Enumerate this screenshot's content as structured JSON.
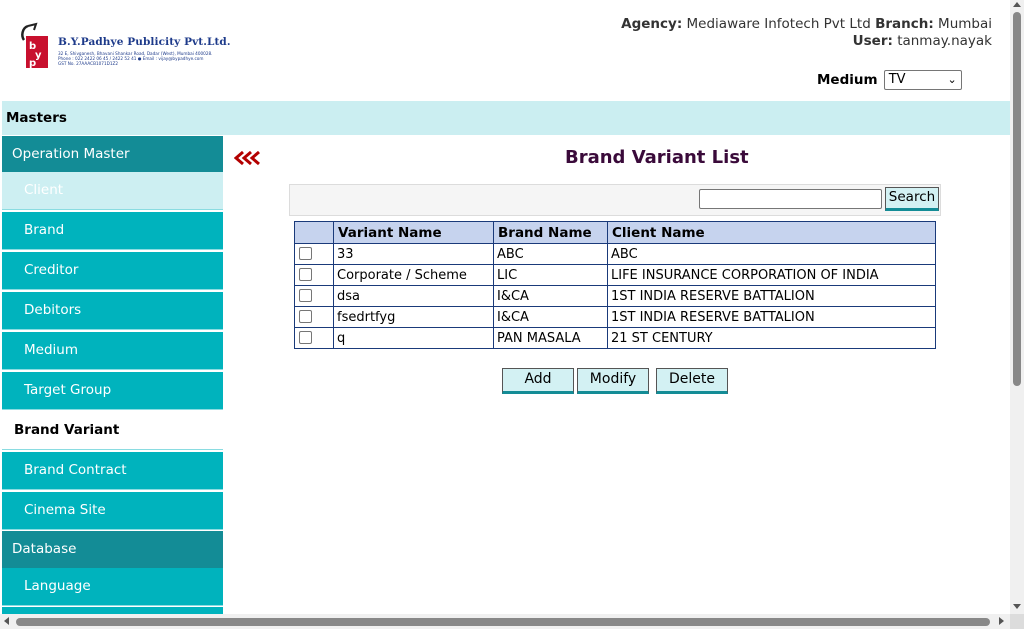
{
  "header": {
    "logo": {
      "company": "B.Y.Padhye Publicity Pvt.Ltd.",
      "address_lines": [
        "32 E, Shivganesh, Bhavani Shankar Road, Dadar (West), Mumbai 400028.",
        "Phone : 022 2422 06 45 / 2422 52 41 ● Email : vijay@bypadhye.com",
        "GST No. 27AAACB1071D1Z2"
      ],
      "mark_letters": "byp"
    },
    "agency_label": "Agency:",
    "agency_value": "Mediaware Infotech Pvt Ltd",
    "branch_label": "Branch:",
    "branch_value": "Mumbai",
    "user_label": "User:",
    "user_value": "tanmay.nayak",
    "medium_label": "Medium",
    "medium_selected": "TV"
  },
  "masters_bar": "Masters",
  "sidebar": [
    {
      "label": "Operation Master",
      "kind": "category"
    },
    {
      "label": "Client",
      "kind": "item",
      "state": "hover"
    },
    {
      "label": "Brand",
      "kind": "item"
    },
    {
      "label": "Creditor",
      "kind": "item"
    },
    {
      "label": "Debitors",
      "kind": "item"
    },
    {
      "label": "Medium",
      "kind": "item"
    },
    {
      "label": "Target Group",
      "kind": "item"
    },
    {
      "label": "Brand Variant",
      "kind": "item",
      "state": "active"
    },
    {
      "label": "Brand Contract",
      "kind": "item"
    },
    {
      "label": "Cinema Site",
      "kind": "item"
    },
    {
      "label": "Database",
      "kind": "category"
    },
    {
      "label": "Language",
      "kind": "item"
    }
  ],
  "main": {
    "title": "Brand Variant List",
    "back_icon": "triple-chevron-left-icon",
    "search": {
      "value": "",
      "button_label": "Search"
    },
    "table": {
      "columns": [
        "",
        "Variant Name",
        "Brand Name",
        "Client Name"
      ],
      "rows": [
        {
          "checked": false,
          "variant": "33",
          "brand": "ABC",
          "client": "ABC"
        },
        {
          "checked": false,
          "variant": "Corporate / Scheme",
          "brand": "LIC",
          "client": "LIFE INSURANCE CORPORATION OF INDIA"
        },
        {
          "checked": false,
          "variant": "dsa",
          "brand": "I&CA",
          "client": "1ST INDIA RESERVE BATTALION"
        },
        {
          "checked": false,
          "variant": "fsedrtfyg",
          "brand": "I&CA",
          "client": "1ST INDIA RESERVE BATTALION"
        },
        {
          "checked": false,
          "variant": "q",
          "brand": "PAN MASALA",
          "client": "21 ST CENTURY"
        }
      ]
    },
    "buttons": {
      "add": "Add",
      "modify": "Modify",
      "delete": "Delete"
    }
  },
  "colors": {
    "sidebar_category": "#138c96",
    "sidebar_item": "#00b3bd",
    "sidebar_hover": "#cdeff2",
    "masters_bar": "#cbeef1",
    "table_header": "#c6d3ee",
    "title": "#3a0a3a",
    "back_icon": "#b30000"
  }
}
